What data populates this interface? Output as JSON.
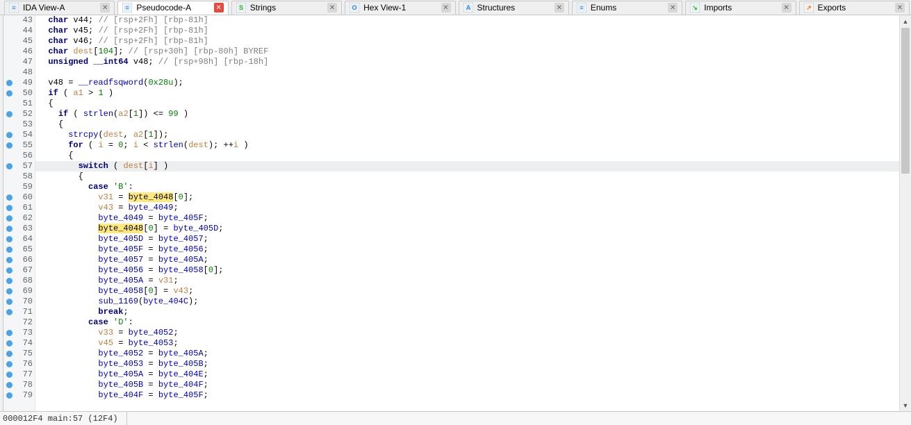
{
  "tabs": [
    {
      "label": "IDA View-A",
      "active": false,
      "close": "grey"
    },
    {
      "label": "Pseudocode-A",
      "active": true,
      "close": "red"
    },
    {
      "label": "Strings",
      "active": false,
      "close": "grey"
    },
    {
      "label": "Hex View-1",
      "active": false,
      "close": "grey"
    },
    {
      "label": "Structures",
      "active": false,
      "close": "grey"
    },
    {
      "label": "Enums",
      "active": false,
      "close": "grey"
    },
    {
      "label": "Imports",
      "active": false,
      "close": "grey"
    },
    {
      "label": "Exports",
      "active": false,
      "close": "grey"
    }
  ],
  "status": "000012F4 main:57 (12F4)",
  "code_lines": [
    {
      "n": 43,
      "dot": false,
      "left": "  ",
      "tokens": [
        {
          "t": "char",
          "c": "kw"
        },
        {
          "t": " v44; "
        },
        {
          "t": "// [rsp+2Fh] [rbp-81h]",
          "c": "cmt"
        }
      ]
    },
    {
      "n": 44,
      "dot": false,
      "left": "  ",
      "tokens": [
        {
          "t": "char",
          "c": "kw"
        },
        {
          "t": " v45; "
        },
        {
          "t": "// [rsp+2Fh] [rbp-81h]",
          "c": "cmt"
        }
      ]
    },
    {
      "n": 45,
      "dot": false,
      "left": "  ",
      "tokens": [
        {
          "t": "char",
          "c": "kw"
        },
        {
          "t": " v46; "
        },
        {
          "t": "// [rsp+2Fh] [rbp-81h]",
          "c": "cmt"
        }
      ]
    },
    {
      "n": 46,
      "dot": false,
      "left": "  ",
      "tokens": [
        {
          "t": "char",
          "c": "kw"
        },
        {
          "t": " "
        },
        {
          "t": "dest",
          "c": "var"
        },
        {
          "t": "["
        },
        {
          "t": "104",
          "c": "grn"
        },
        {
          "t": "]; "
        },
        {
          "t": "// [rsp+30h] [rbp-80h] BYREF",
          "c": "cmt"
        }
      ]
    },
    {
      "n": 47,
      "dot": false,
      "left": "  ",
      "tokens": [
        {
          "t": "unsigned",
          "c": "kw"
        },
        {
          "t": " "
        },
        {
          "t": "__int64",
          "c": "kw"
        },
        {
          "t": " v48; "
        },
        {
          "t": "// [rsp+98h] [rbp-18h]",
          "c": "cmt"
        }
      ]
    },
    {
      "n": 48,
      "dot": false,
      "left": "",
      "tokens": []
    },
    {
      "n": 49,
      "dot": true,
      "left": "  ",
      "tokens": [
        {
          "t": "v48 = "
        },
        {
          "t": "__readfsqword",
          "c": "blu"
        },
        {
          "t": "("
        },
        {
          "t": "0x28u",
          "c": "grn"
        },
        {
          "t": ");"
        }
      ]
    },
    {
      "n": 50,
      "dot": true,
      "left": "  ",
      "tokens": [
        {
          "t": "if",
          "c": "kw"
        },
        {
          "t": " ( "
        },
        {
          "t": "a1",
          "c": "var"
        },
        {
          "t": " > "
        },
        {
          "t": "1",
          "c": "grn"
        },
        {
          "t": " )"
        }
      ]
    },
    {
      "n": 51,
      "dot": false,
      "left": "  ",
      "tokens": [
        {
          "t": "{"
        }
      ]
    },
    {
      "n": 52,
      "dot": true,
      "left": "    ",
      "tokens": [
        {
          "t": "if",
          "c": "kw"
        },
        {
          "t": " ( "
        },
        {
          "t": "strlen",
          "c": "blu"
        },
        {
          "t": "("
        },
        {
          "t": "a2",
          "c": "var"
        },
        {
          "t": "["
        },
        {
          "t": "1",
          "c": "grn"
        },
        {
          "t": "]) <= "
        },
        {
          "t": "99",
          "c": "grn"
        },
        {
          "t": " )"
        }
      ]
    },
    {
      "n": 53,
      "dot": false,
      "left": "    ",
      "tokens": [
        {
          "t": "{"
        }
      ]
    },
    {
      "n": 54,
      "dot": true,
      "left": "      ",
      "tokens": [
        {
          "t": "strcpy",
          "c": "blu"
        },
        {
          "t": "("
        },
        {
          "t": "dest",
          "c": "var"
        },
        {
          "t": ", "
        },
        {
          "t": "a2",
          "c": "var"
        },
        {
          "t": "["
        },
        {
          "t": "1",
          "c": "grn"
        },
        {
          "t": "]);"
        }
      ]
    },
    {
      "n": 55,
      "dot": true,
      "left": "      ",
      "tokens": [
        {
          "t": "for",
          "c": "kw"
        },
        {
          "t": " ( "
        },
        {
          "t": "i",
          "c": "var"
        },
        {
          "t": " = "
        },
        {
          "t": "0",
          "c": "grn"
        },
        {
          "t": "; "
        },
        {
          "t": "i",
          "c": "var"
        },
        {
          "t": " < "
        },
        {
          "t": "strlen",
          "c": "blu"
        },
        {
          "t": "("
        },
        {
          "t": "dest",
          "c": "var"
        },
        {
          "t": "); ++"
        },
        {
          "t": "i",
          "c": "var"
        },
        {
          "t": " )"
        }
      ]
    },
    {
      "n": 56,
      "dot": false,
      "left": "      ",
      "tokens": [
        {
          "t": "{"
        }
      ]
    },
    {
      "n": 57,
      "dot": true,
      "current": true,
      "left": "        ",
      "tokens": [
        {
          "t": "switch",
          "c": "kw"
        },
        {
          "t": " ( "
        },
        {
          "t": "dest",
          "c": "var"
        },
        {
          "t": "["
        },
        {
          "t": "i",
          "c": "var"
        },
        {
          "t": "] )"
        }
      ]
    },
    {
      "n": 58,
      "dot": false,
      "left": "        ",
      "tokens": [
        {
          "t": "{"
        }
      ]
    },
    {
      "n": 59,
      "dot": false,
      "left": "          ",
      "tokens": [
        {
          "t": "case",
          "c": "kw"
        },
        {
          "t": " "
        },
        {
          "t": "'B'",
          "c": "grn"
        },
        {
          "t": ":"
        }
      ]
    },
    {
      "n": 60,
      "dot": true,
      "left": "            ",
      "tokens": [
        {
          "t": "v31",
          "c": "var"
        },
        {
          "t": " = "
        },
        {
          "t": "byte_4048",
          "c": "hl"
        },
        {
          "t": "["
        },
        {
          "t": "0",
          "c": "grn"
        },
        {
          "t": "];"
        }
      ]
    },
    {
      "n": 61,
      "dot": true,
      "left": "            ",
      "tokens": [
        {
          "t": "v43",
          "c": "var"
        },
        {
          "t": " = "
        },
        {
          "t": "byte_4049",
          "c": "blu"
        },
        {
          "t": ";"
        }
      ]
    },
    {
      "n": 62,
      "dot": true,
      "left": "            ",
      "tokens": [
        {
          "t": "byte_4049",
          "c": "blu"
        },
        {
          "t": " = "
        },
        {
          "t": "byte_405F",
          "c": "blu"
        },
        {
          "t": ";"
        }
      ]
    },
    {
      "n": 63,
      "dot": true,
      "left": "            ",
      "tokens": [
        {
          "t": "byte_4048",
          "c": "hl"
        },
        {
          "t": "["
        },
        {
          "t": "0",
          "c": "grn"
        },
        {
          "t": "] = "
        },
        {
          "t": "byte_405D",
          "c": "blu"
        },
        {
          "t": ";"
        }
      ]
    },
    {
      "n": 64,
      "dot": true,
      "left": "            ",
      "tokens": [
        {
          "t": "byte_405D",
          "c": "blu"
        },
        {
          "t": " = "
        },
        {
          "t": "byte_4057",
          "c": "blu"
        },
        {
          "t": ";"
        }
      ]
    },
    {
      "n": 65,
      "dot": true,
      "left": "            ",
      "tokens": [
        {
          "t": "byte_405F",
          "c": "blu"
        },
        {
          "t": " = "
        },
        {
          "t": "byte_4056",
          "c": "blu"
        },
        {
          "t": ";"
        }
      ]
    },
    {
      "n": 66,
      "dot": true,
      "left": "            ",
      "tokens": [
        {
          "t": "byte_4057",
          "c": "blu"
        },
        {
          "t": " = "
        },
        {
          "t": "byte_405A",
          "c": "blu"
        },
        {
          "t": ";"
        }
      ]
    },
    {
      "n": 67,
      "dot": true,
      "left": "            ",
      "tokens": [
        {
          "t": "byte_4056",
          "c": "blu"
        },
        {
          "t": " = "
        },
        {
          "t": "byte_4058",
          "c": "blu"
        },
        {
          "t": "["
        },
        {
          "t": "0",
          "c": "grn"
        },
        {
          "t": "];"
        }
      ]
    },
    {
      "n": 68,
      "dot": true,
      "left": "            ",
      "tokens": [
        {
          "t": "byte_405A",
          "c": "blu"
        },
        {
          "t": " = "
        },
        {
          "t": "v31",
          "c": "var"
        },
        {
          "t": ";"
        }
      ]
    },
    {
      "n": 69,
      "dot": true,
      "left": "            ",
      "tokens": [
        {
          "t": "byte_4058",
          "c": "blu"
        },
        {
          "t": "["
        },
        {
          "t": "0",
          "c": "grn"
        },
        {
          "t": "] = "
        },
        {
          "t": "v43",
          "c": "var"
        },
        {
          "t": ";"
        }
      ]
    },
    {
      "n": 70,
      "dot": true,
      "left": "            ",
      "tokens": [
        {
          "t": "sub_1169",
          "c": "blu"
        },
        {
          "t": "("
        },
        {
          "t": "byte_404C",
          "c": "blu"
        },
        {
          "t": ");"
        }
      ]
    },
    {
      "n": 71,
      "dot": true,
      "left": "            ",
      "tokens": [
        {
          "t": "break",
          "c": "kw"
        },
        {
          "t": ";"
        }
      ]
    },
    {
      "n": 72,
      "dot": false,
      "left": "          ",
      "tokens": [
        {
          "t": "case",
          "c": "kw"
        },
        {
          "t": " "
        },
        {
          "t": "'D'",
          "c": "grn"
        },
        {
          "t": ":"
        }
      ]
    },
    {
      "n": 73,
      "dot": true,
      "left": "            ",
      "tokens": [
        {
          "t": "v33",
          "c": "var"
        },
        {
          "t": " = "
        },
        {
          "t": "byte_4052",
          "c": "blu"
        },
        {
          "t": ";"
        }
      ]
    },
    {
      "n": 74,
      "dot": true,
      "left": "            ",
      "tokens": [
        {
          "t": "v45",
          "c": "var"
        },
        {
          "t": " = "
        },
        {
          "t": "byte_4053",
          "c": "blu"
        },
        {
          "t": ";"
        }
      ]
    },
    {
      "n": 75,
      "dot": true,
      "left": "            ",
      "tokens": [
        {
          "t": "byte_4052",
          "c": "blu"
        },
        {
          "t": " = "
        },
        {
          "t": "byte_405A",
          "c": "blu"
        },
        {
          "t": ";"
        }
      ]
    },
    {
      "n": 76,
      "dot": true,
      "left": "            ",
      "tokens": [
        {
          "t": "byte_4053",
          "c": "blu"
        },
        {
          "t": " = "
        },
        {
          "t": "byte_405B",
          "c": "blu"
        },
        {
          "t": ";"
        }
      ]
    },
    {
      "n": 77,
      "dot": true,
      "left": "            ",
      "tokens": [
        {
          "t": "byte_405A",
          "c": "blu"
        },
        {
          "t": " = "
        },
        {
          "t": "byte_404E",
          "c": "blu"
        },
        {
          "t": ";"
        }
      ]
    },
    {
      "n": 78,
      "dot": true,
      "left": "            ",
      "tokens": [
        {
          "t": "byte_405B",
          "c": "blu"
        },
        {
          "t": " = "
        },
        {
          "t": "byte_404F",
          "c": "blu"
        },
        {
          "t": ";"
        }
      ]
    },
    {
      "n": 79,
      "dot": true,
      "left": "            ",
      "tokens": [
        {
          "t": "byte_404F",
          "c": "blu"
        },
        {
          "t": " = "
        },
        {
          "t": "byte_405F",
          "c": "blu"
        },
        {
          "t": ";"
        }
      ]
    }
  ]
}
